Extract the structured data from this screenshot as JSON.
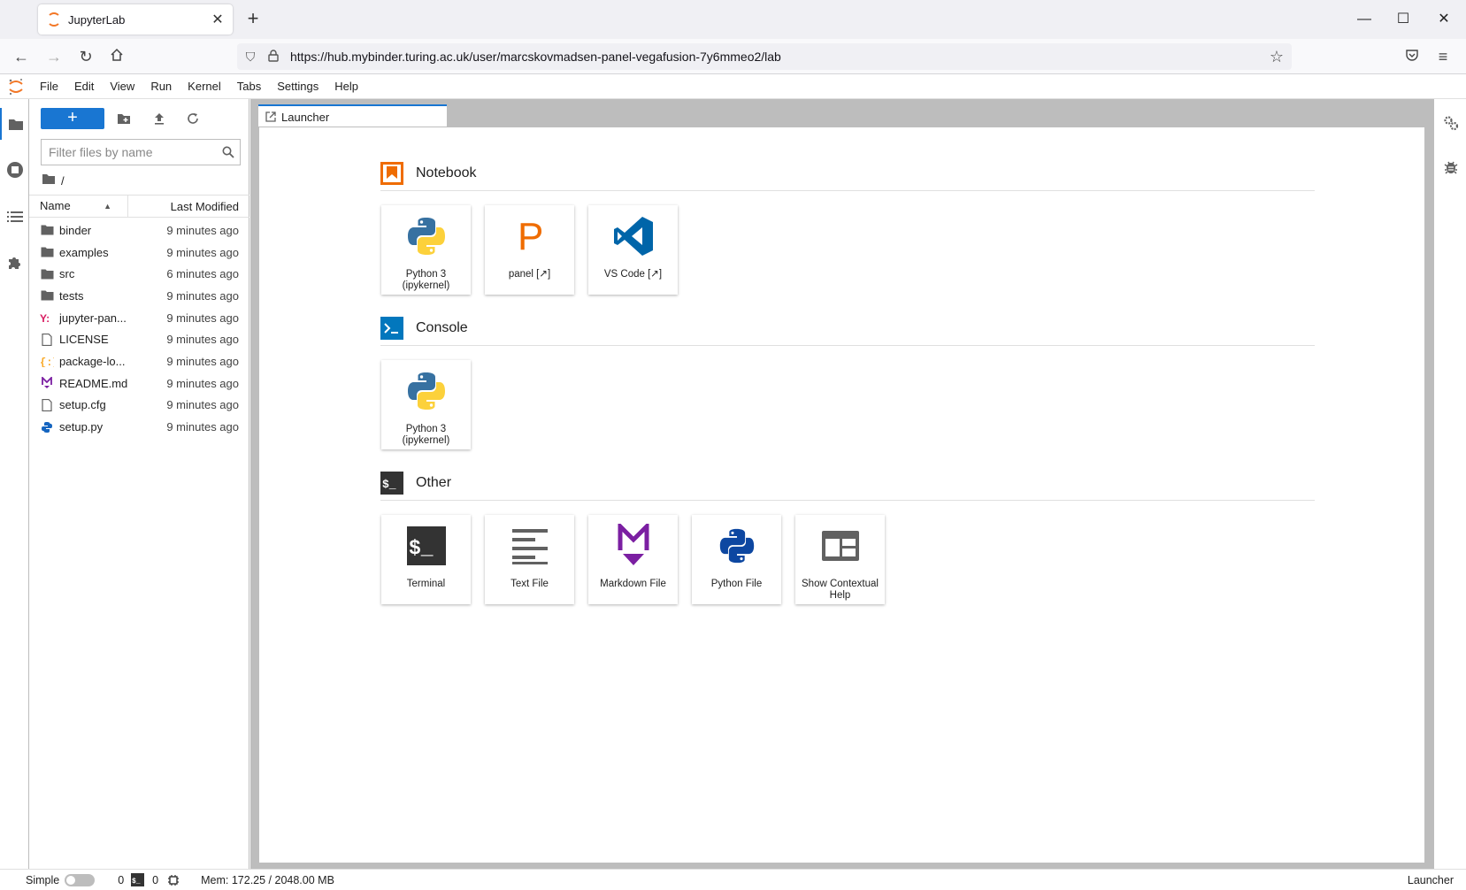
{
  "browser": {
    "tab_title": "JupyterLab",
    "url": "https://hub.mybinder.turing.ac.uk/user/marcskovmadsen-panel-vegafusion-7y6mmeo2/lab"
  },
  "menubar": {
    "items": [
      "File",
      "Edit",
      "View",
      "Run",
      "Kernel",
      "Tabs",
      "Settings",
      "Help"
    ]
  },
  "filebrowser": {
    "new_button_label": "+",
    "filter_placeholder": "Filter files by name",
    "breadcrumb": "/",
    "columns": {
      "name": "Name",
      "modified": "Last Modified"
    },
    "files": [
      {
        "name": "binder",
        "type": "folder",
        "modified": "9 minutes ago"
      },
      {
        "name": "examples",
        "type": "folder",
        "modified": "9 minutes ago"
      },
      {
        "name": "src",
        "type": "folder",
        "modified": "6 minutes ago"
      },
      {
        "name": "tests",
        "type": "folder",
        "modified": "9 minutes ago"
      },
      {
        "name": "jupyter-pan...",
        "type": "yaml",
        "modified": "9 minutes ago"
      },
      {
        "name": "LICENSE",
        "type": "file",
        "modified": "9 minutes ago"
      },
      {
        "name": "package-lo...",
        "type": "json",
        "modified": "9 minutes ago"
      },
      {
        "name": "README.md",
        "type": "markdown",
        "modified": "9 minutes ago"
      },
      {
        "name": "setup.cfg",
        "type": "file",
        "modified": "9 minutes ago"
      },
      {
        "name": "setup.py",
        "type": "python",
        "modified": "9 minutes ago"
      }
    ]
  },
  "main": {
    "tab_label": "Launcher",
    "sections": [
      {
        "title": "Notebook",
        "icon": "notebook-icon",
        "cards": [
          {
            "label": "Python 3 (ipykernel)",
            "icon": "python-logo-icon"
          },
          {
            "label": "panel [↗]",
            "icon": "panel-p-icon"
          },
          {
            "label": "VS Code [↗]",
            "icon": "vscode-icon"
          }
        ]
      },
      {
        "title": "Console",
        "icon": "console-icon",
        "cards": [
          {
            "label": "Python 3 (ipykernel)",
            "icon": "python-logo-icon"
          }
        ]
      },
      {
        "title": "Other",
        "icon": "other-terminal-icon",
        "cards": [
          {
            "label": "Terminal",
            "icon": "terminal-icon"
          },
          {
            "label": "Text File",
            "icon": "text-file-icon"
          },
          {
            "label": "Markdown File",
            "icon": "markdown-icon"
          },
          {
            "label": "Python File",
            "icon": "python-file-icon"
          },
          {
            "label": "Show Contextual Help",
            "icon": "contextual-help-icon"
          }
        ]
      }
    ]
  },
  "statusbar": {
    "mode_label": "Simple",
    "kernels_count": "0",
    "terminals_count": "0",
    "memory": "Mem: 172.25 / 2048.00 MB",
    "active_label": "Launcher"
  },
  "colors": {
    "accent": "#1976d2",
    "jupyter_orange": "#f37726",
    "notebook_icon": "#ef6c00",
    "console_icon": "#0277bd",
    "markdown_purple": "#7b1fa2"
  }
}
